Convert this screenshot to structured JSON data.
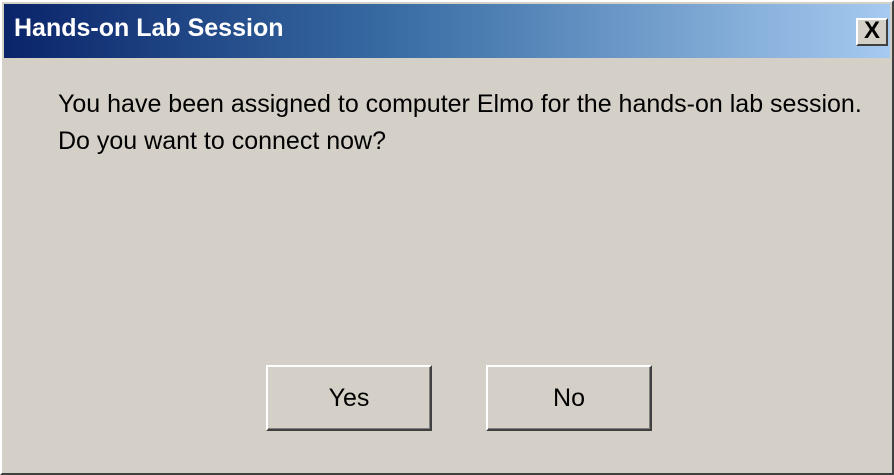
{
  "window": {
    "title": "Hands-on Lab Session",
    "close_glyph": "X"
  },
  "message": "You have been assigned to computer Elmo for the hands-on lab session. Do you want to connect now?",
  "buttons": {
    "yes_label": "Yes",
    "no_label": "No"
  },
  "colors": {
    "titlebar_start": "#0a246a",
    "titlebar_end": "#a6caf0",
    "dialog_face": "#d4d0c8"
  },
  "icons": {
    "close": "close-icon"
  }
}
